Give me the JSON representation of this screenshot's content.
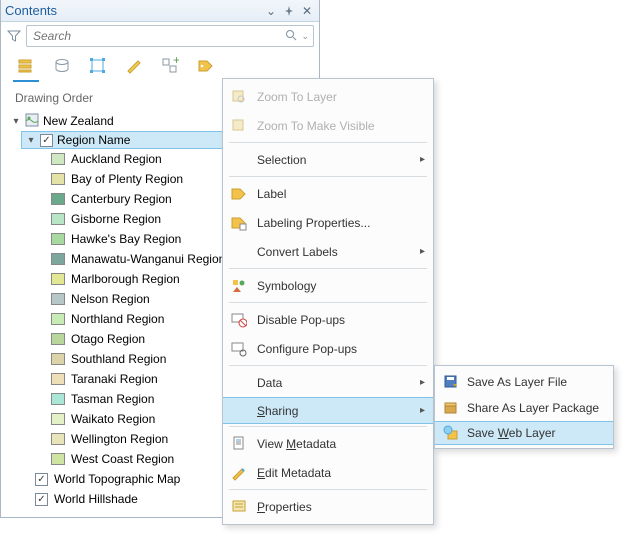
{
  "panel": {
    "title": "Contents",
    "search_placeholder": "Search",
    "section_title": "Drawing Order"
  },
  "tree": {
    "root": "New Zealand",
    "selected_layer": "Region Name",
    "regions": [
      {
        "name": "Auckland Region",
        "color": "#cfe8c2"
      },
      {
        "name": "Bay of Plenty Region",
        "color": "#e4e2a6"
      },
      {
        "name": "Canterbury Region",
        "color": "#6aa98c"
      },
      {
        "name": "Gisborne Region",
        "color": "#b8e5c6"
      },
      {
        "name": "Hawke's Bay Region",
        "color": "#a8d9a1"
      },
      {
        "name": "Manawatu-Wanganui Region",
        "color": "#7da79c"
      },
      {
        "name": "Marlborough Region",
        "color": "#e2e793"
      },
      {
        "name": "Nelson Region",
        "color": "#b7c7c7"
      },
      {
        "name": "Northland Region",
        "color": "#c8ebb5"
      },
      {
        "name": "Otago Region",
        "color": "#b9d69d"
      },
      {
        "name": "Southland Region",
        "color": "#dcd3a8"
      },
      {
        "name": "Taranaki Region",
        "color": "#ede0b9"
      },
      {
        "name": "Tasman Region",
        "color": "#a9e6d6"
      },
      {
        "name": "Waikato Region",
        "color": "#e4f0c6"
      },
      {
        "name": "Wellington Region",
        "color": "#e6e4b8"
      },
      {
        "name": "West Coast Region",
        "color": "#cfe4a3"
      }
    ],
    "basemaps": [
      "World Topographic Map",
      "World Hillshade"
    ]
  },
  "context_menu": {
    "zoom_to_layer": "Zoom To Layer",
    "zoom_visible": "Zoom To Make Visible",
    "selection": "Selection",
    "label": "Label",
    "labeling_props": "Labeling Properties...",
    "convert_labels": "Convert Labels",
    "symbology": "Symbology",
    "disable_popups": "Disable Pop-ups",
    "configure_popups": "Configure Pop-ups",
    "data": "Data",
    "sharing": "Sharing",
    "view_metadata": "View Metadata",
    "edit_metadata": "Edit Metadata",
    "properties": "Properties"
  },
  "sharing_submenu": {
    "save_layer_file": "Save As Layer File",
    "share_package": "Share As Layer Package",
    "save_web_layer": "Save Web Layer"
  }
}
